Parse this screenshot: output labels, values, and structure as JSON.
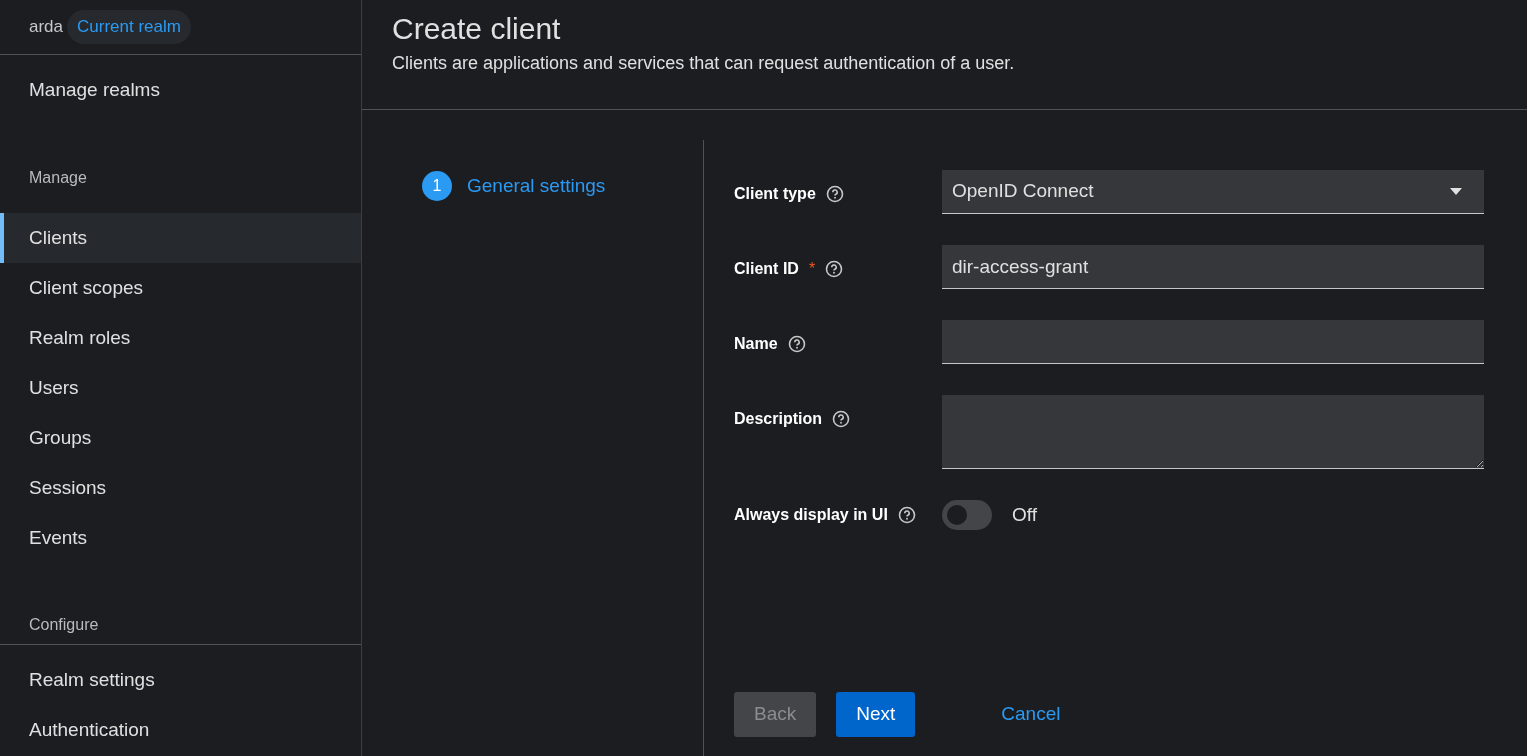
{
  "realm": {
    "name": "arda",
    "badge": "Current realm"
  },
  "sidebar": {
    "top_link": "Manage realms",
    "sections": [
      {
        "title": "Manage",
        "items": [
          {
            "label": "Clients",
            "selected": true
          },
          {
            "label": "Client scopes",
            "selected": false
          },
          {
            "label": "Realm roles",
            "selected": false
          },
          {
            "label": "Users",
            "selected": false
          },
          {
            "label": "Groups",
            "selected": false
          },
          {
            "label": "Sessions",
            "selected": false
          },
          {
            "label": "Events",
            "selected": false
          }
        ]
      },
      {
        "title": "Configure",
        "items": [
          {
            "label": "Realm settings",
            "selected": false
          },
          {
            "label": "Authentication",
            "selected": false
          }
        ]
      }
    ]
  },
  "page": {
    "title": "Create client",
    "subtitle": "Clients are applications and services that can request authentication of a user."
  },
  "wizard": {
    "steps": [
      {
        "number": "1",
        "label": "General settings",
        "selected": true
      }
    ]
  },
  "form": {
    "fields": [
      {
        "kind": "select",
        "label": "Client type",
        "value": "OpenID Connect"
      },
      {
        "kind": "text",
        "label": "Client ID",
        "required_mark": "*",
        "value": "dir-access-grant"
      },
      {
        "kind": "text",
        "label": "Name"
      },
      {
        "kind": "textarea",
        "label": "Description"
      },
      {
        "kind": "switch",
        "label": "Always display in UI",
        "on": false,
        "state_label": "Off"
      }
    ]
  },
  "buttons": [
    {
      "kind": "secondary",
      "label": "Back",
      "disabled": true
    },
    {
      "kind": "primary",
      "label": "Next",
      "disabled": false
    },
    {
      "kind": "link",
      "label": "Cancel",
      "disabled": false
    }
  ]
}
